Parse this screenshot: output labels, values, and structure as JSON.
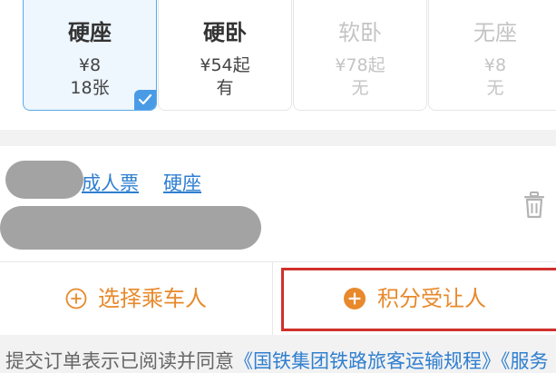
{
  "seats": [
    {
      "name": "硬座",
      "price": "¥8",
      "count": "18张",
      "state": "selected"
    },
    {
      "name": "硬卧",
      "price": "¥54起",
      "count": "有",
      "state": "available"
    },
    {
      "name": "软卧",
      "price": "¥78起",
      "count": "无",
      "state": "disabled"
    },
    {
      "name": "无座",
      "price": "¥8",
      "count": "无",
      "state": "disabled"
    }
  ],
  "passenger": {
    "ticket_type": "成人票",
    "seat_type": "硬座"
  },
  "actions": {
    "select_passenger": "选择乘车人",
    "points_transferee": "积分受让人"
  },
  "agreement": {
    "prefix": "提交订单表示已阅读并同意",
    "link1": "《国铁集团铁路旅客运输规程》",
    "link2": "《服务"
  },
  "colors": {
    "accent_orange": "#e8892b",
    "link_blue": "#2f7fd0",
    "selected_border": "#5aa9ea",
    "highlight_red": "#d0302b"
  },
  "icons": {
    "check": "check-icon",
    "trash": "trash-icon",
    "plus_outline": "plus-circle-outline-icon",
    "plus_filled": "plus-circle-filled-icon"
  }
}
